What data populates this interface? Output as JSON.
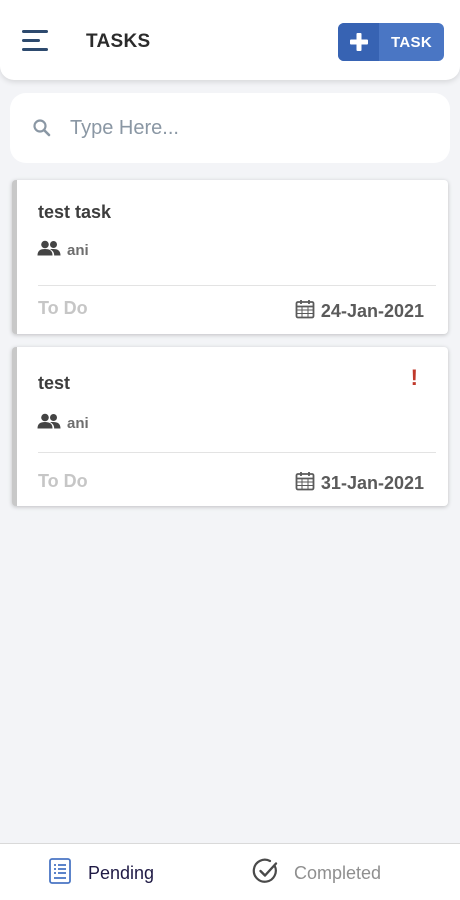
{
  "header": {
    "title": "TASKS",
    "add_button_label": "TASK",
    "menu_icon": "hamburger-menu-icon",
    "plus_icon": "plus-icon"
  },
  "search": {
    "placeholder": "Type Here...",
    "value": "",
    "icon": "search-icon"
  },
  "tasks": [
    {
      "title": "test task",
      "assignee": "ani",
      "status": "To Do",
      "due_date": "24-Jan-2021",
      "high_priority": false
    },
    {
      "title": "test",
      "assignee": "ani",
      "status": "To Do",
      "due_date": "31-Jan-2021",
      "high_priority": true,
      "priority_mark": "!"
    }
  ],
  "bottom_nav": {
    "items": [
      {
        "label": "Pending",
        "icon": "checklist-icon",
        "active": true
      },
      {
        "label": "Completed",
        "icon": "check-circle-icon",
        "active": false
      }
    ]
  },
  "colors": {
    "accent": "#3763b3",
    "accent_light": "#4a76c4",
    "priority": "#c0392b",
    "status_text": "#c6c6c6",
    "card_border": "#c8c8c8",
    "background": "#f3f4f7"
  }
}
